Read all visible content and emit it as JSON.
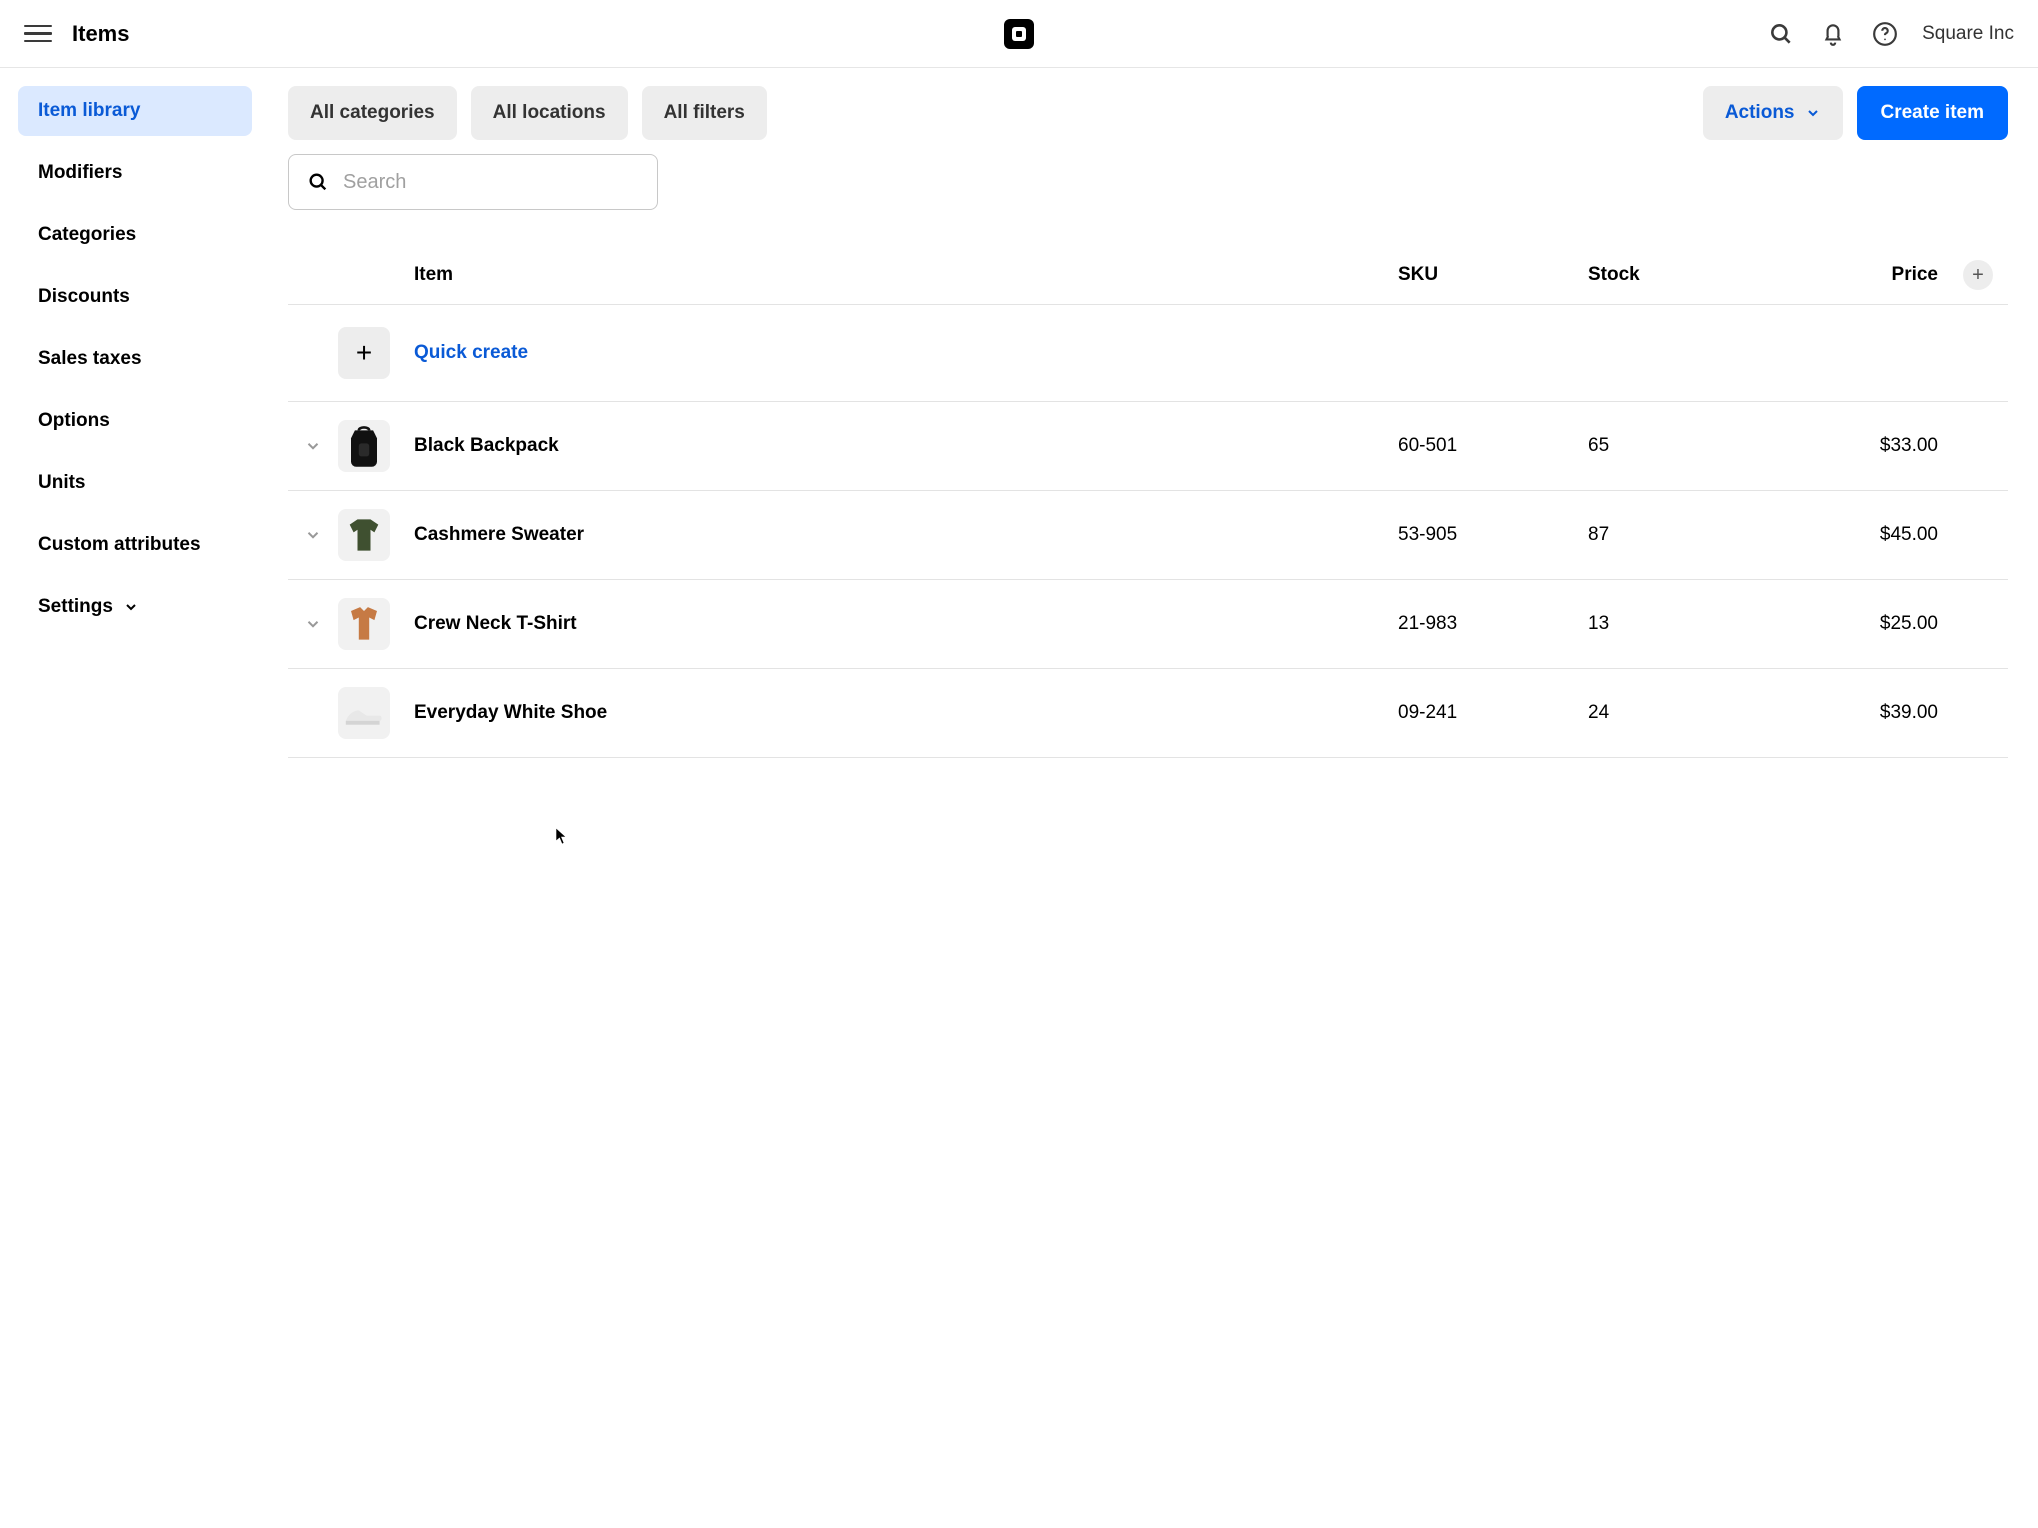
{
  "header": {
    "title": "Items",
    "company": "Square Inc"
  },
  "sidebar": {
    "items": [
      {
        "label": "Item library",
        "active": true,
        "has_chevron": false
      },
      {
        "label": "Modifiers",
        "active": false,
        "has_chevron": false
      },
      {
        "label": "Categories",
        "active": false,
        "has_chevron": false
      },
      {
        "label": "Discounts",
        "active": false,
        "has_chevron": false
      },
      {
        "label": "Sales taxes",
        "active": false,
        "has_chevron": false
      },
      {
        "label": "Options",
        "active": false,
        "has_chevron": false
      },
      {
        "label": "Units",
        "active": false,
        "has_chevron": false
      },
      {
        "label": "Custom attributes",
        "active": false,
        "has_chevron": false
      },
      {
        "label": "Settings",
        "active": false,
        "has_chevron": true
      }
    ]
  },
  "filters": {
    "categories": "All categories",
    "locations": "All locations",
    "filters": "All filters"
  },
  "actions": {
    "actions_label": "Actions",
    "create_label": "Create item"
  },
  "search": {
    "placeholder": "Search",
    "value": ""
  },
  "table": {
    "columns": {
      "item": "Item",
      "sku": "SKU",
      "stock": "Stock",
      "price": "Price"
    },
    "quick_create_label": "Quick create",
    "rows": [
      {
        "name": "Black Backpack",
        "sku": "60-501",
        "stock": "65",
        "price": "$33.00",
        "expandable": true,
        "thumb": "backpack"
      },
      {
        "name": "Cashmere Sweater",
        "sku": "53-905",
        "stock": "87",
        "price": "$45.00",
        "expandable": true,
        "thumb": "sweater"
      },
      {
        "name": "Crew Neck T-Shirt",
        "sku": "21-983",
        "stock": "13",
        "price": "$25.00",
        "expandable": true,
        "thumb": "shirt"
      },
      {
        "name": "Everyday White Shoe",
        "sku": "09-241",
        "stock": "24",
        "price": "$39.00",
        "expandable": false,
        "thumb": "shoe"
      }
    ]
  },
  "colors": {
    "accent": "#006aff",
    "sidebar_active_bg": "#dbe9ff",
    "sidebar_active_fg": "#0a5ad6"
  }
}
